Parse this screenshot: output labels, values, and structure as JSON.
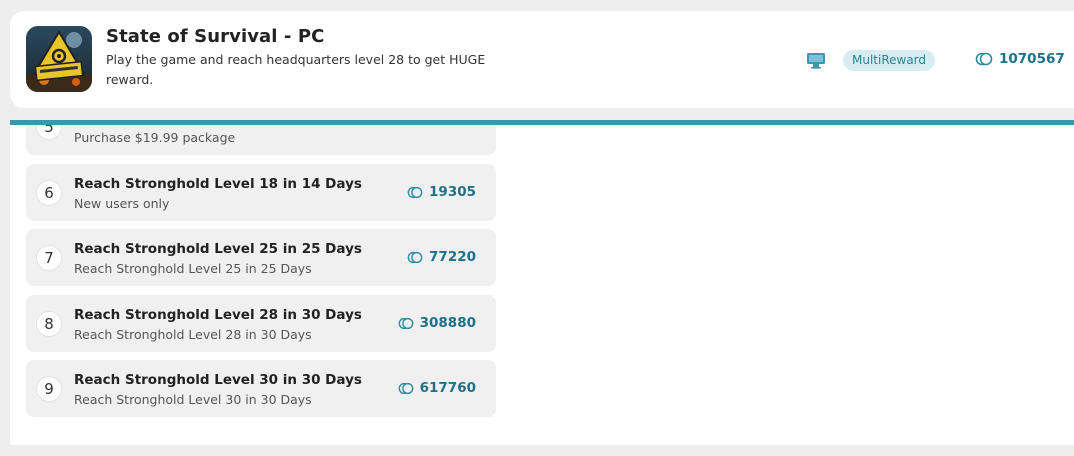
{
  "header": {
    "title": "State of Survival - PC",
    "description": "Play the game and reach headquarters level 28 to get HUGE reward.",
    "icon": "game-logo",
    "platform_icon": "desktop-monitor-icon",
    "badge": "MultiReward",
    "total_reward": "1070567",
    "accent_color": "#3a97ae"
  },
  "tasks": [
    {
      "number": "5",
      "title": "",
      "subtitle": "Purchase $19.99 package",
      "reward": ""
    },
    {
      "number": "6",
      "title": "Reach Stronghold Level 18 in 14 Days",
      "subtitle": "New users only",
      "reward": "19305"
    },
    {
      "number": "7",
      "title": "Reach Stronghold Level 25 in 25 Days",
      "subtitle": "Reach Stronghold Level 25 in 25 Days",
      "reward": "77220"
    },
    {
      "number": "8",
      "title": "Reach Stronghold Level 28 in 30 Days",
      "subtitle": "Reach Stronghold Level 28 in 30 Days",
      "reward": "308880"
    },
    {
      "number": "9",
      "title": "Reach Stronghold Level 30 in 30 Days",
      "subtitle": "Reach Stronghold Level 30 in 30 Days",
      "reward": "617760"
    }
  ]
}
